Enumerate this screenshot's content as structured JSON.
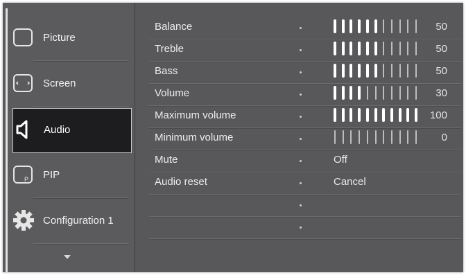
{
  "sidebar": {
    "items": [
      {
        "label": "Picture",
        "icon": "picture-icon"
      },
      {
        "label": "Screen",
        "icon": "screen-icon"
      },
      {
        "label": "Audio",
        "icon": "speaker-icon",
        "active": true
      },
      {
        "label": "PIP",
        "icon": "pip-icon"
      },
      {
        "label": "Configuration 1",
        "icon": "gear-icon"
      }
    ],
    "more_icon": "chevron-down-icon"
  },
  "audio": {
    "sliders": [
      {
        "label": "Balance",
        "value": 50
      },
      {
        "label": "Treble",
        "value": 50
      },
      {
        "label": "Bass",
        "value": 50
      },
      {
        "label": "Volume",
        "value": 30
      },
      {
        "label": "Maximum volume",
        "value": 100
      },
      {
        "label": "Minimum volume",
        "value": 0
      }
    ],
    "options": [
      {
        "label": "Mute",
        "value": "Off"
      },
      {
        "label": "Audio reset",
        "value": "Cancel"
      }
    ],
    "slider_max": 100,
    "tick_count": 11
  },
  "colors": {
    "background": "#58585a",
    "active_item": "#1d1d1f",
    "tick_on": "#ffffff",
    "tick_off": "#bdbdbf"
  }
}
